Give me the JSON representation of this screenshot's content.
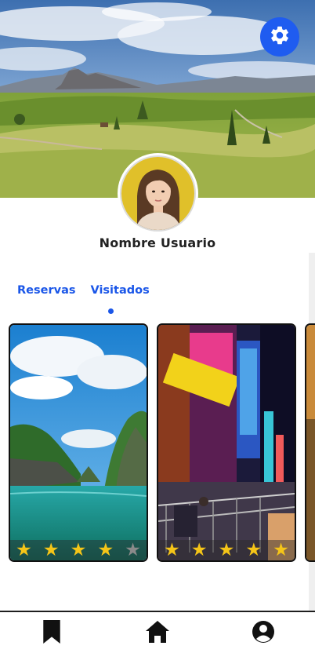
{
  "profile": {
    "username": "Nombre Usuario"
  },
  "tabs": [
    {
      "label": "Reservas",
      "active": false
    },
    {
      "label": "Visitados",
      "active": true
    }
  ],
  "cards": [
    {
      "name": "tropical-bay-card",
      "rating": 4,
      "max_rating": 5
    },
    {
      "name": "city-lights-card",
      "rating": 5,
      "max_rating": 5
    }
  ],
  "icons": {
    "settings": "gear-icon",
    "nav": [
      "bookmark-icon",
      "home-icon",
      "account-icon"
    ]
  },
  "colors": {
    "accent": "#1a56e8",
    "settings_bg": "#1f5cf0",
    "star_filled": "#f5c518",
    "star_empty": "#8a8a8a"
  }
}
